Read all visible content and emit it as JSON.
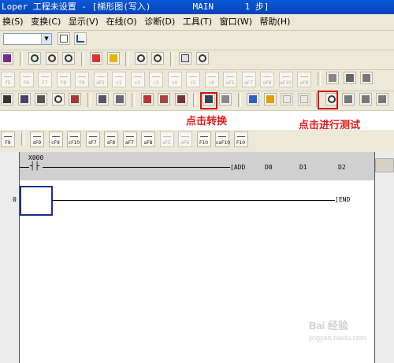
{
  "title_bar": {
    "text": "Loper 工程未设置 - [梯形图(写入)        MAIN      1 步]"
  },
  "menu": {
    "items": [
      "换(S)",
      "变换(C)",
      "显示(V)",
      "在线(O)",
      "诊断(D)",
      "工具(T)",
      "窗口(W)",
      "帮助(H)"
    ]
  },
  "ladder": {
    "contact_label": "X000",
    "instruction": "[ADD",
    "operands": [
      "D0",
      "D1",
      "D2"
    ],
    "step_number": "0",
    "end_instruction": "[END"
  },
  "annotations": {
    "convert_note": "点击转换",
    "test_note": "点击进行测试"
  },
  "function_keys": {
    "row1": [
      "F5",
      "F6",
      "F7",
      "F8",
      "F9",
      "sF5",
      "c1",
      "c2",
      "c3",
      "c4",
      "c5",
      "c6",
      "aF5",
      "aF7",
      "aF8",
      "aF10",
      "aF9"
    ],
    "row2": [
      "F9",
      "sF9",
      "cF9",
      "cF10",
      "sF7",
      "sF8",
      "aF7",
      "aF8",
      "sF5",
      "sF6",
      "F10",
      "caF10",
      "F10"
    ]
  },
  "watermark": {
    "brand": "Bai 经验",
    "url": "jingyan.baidu.com"
  },
  "colors": {
    "highlight": "#d21010",
    "title_bar": "#0a58d8",
    "cursor": "#1c2f8c"
  }
}
